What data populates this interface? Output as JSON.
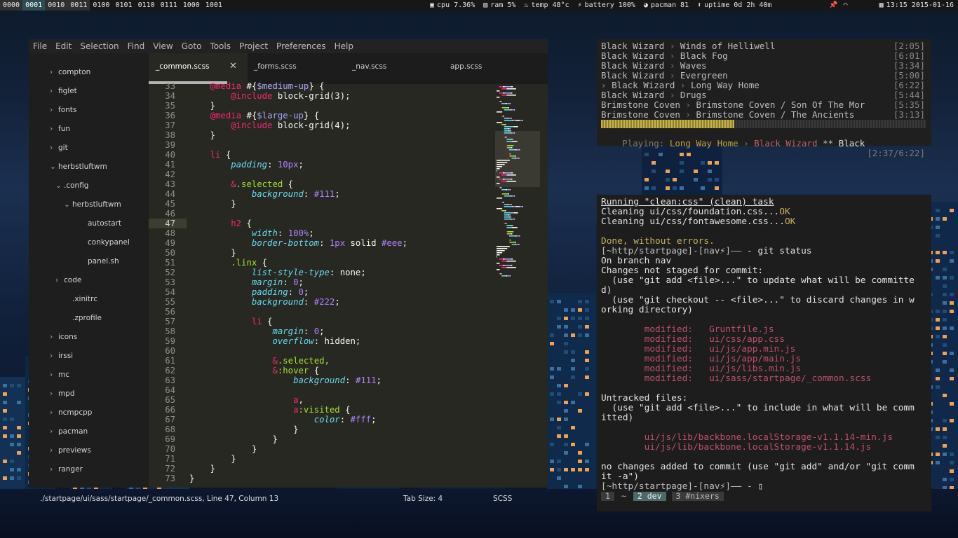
{
  "topbar": {
    "workspaces": [
      {
        "label": "0000",
        "state": "occ"
      },
      {
        "label": "0001",
        "state": "active"
      },
      {
        "label": "0010",
        "state": "occ"
      },
      {
        "label": "0011",
        "state": "occ"
      },
      {
        "label": "0100",
        "state": ""
      },
      {
        "label": "0101",
        "state": ""
      },
      {
        "label": "0110",
        "state": ""
      },
      {
        "label": "0111",
        "state": ""
      },
      {
        "label": "1000",
        "state": ""
      },
      {
        "label": "1001",
        "state": ""
      }
    ],
    "stats": [
      {
        "icon": "cpu-icon",
        "glyph": "▣",
        "text": "cpu 7.36%"
      },
      {
        "icon": "ram-icon",
        "glyph": "▤",
        "text": "ram 5%"
      },
      {
        "icon": "temperature-icon",
        "glyph": "♨",
        "text": "temp 48°c"
      },
      {
        "icon": "battery-icon",
        "glyph": "⚡",
        "text": "battery 100%"
      },
      {
        "icon": "package-icon",
        "glyph": "◕",
        "text": "pacman 81"
      },
      {
        "icon": "uptime-arrow-icon",
        "glyph": "⬆",
        "text": "uptime 0d 2h 40m"
      }
    ],
    "clock": "13:15 2015-01-16"
  },
  "editor": {
    "menu": [
      "File",
      "Edit",
      "Selection",
      "Find",
      "View",
      "Goto",
      "Tools",
      "Project",
      "Preferences",
      "Help"
    ],
    "tree": [
      {
        "label": "compton",
        "depth": 0,
        "chev": "›"
      },
      {
        "label": "figlet",
        "depth": 0,
        "chev": "›"
      },
      {
        "label": "fonts",
        "depth": 0,
        "chev": "›"
      },
      {
        "label": "fun",
        "depth": 0,
        "chev": "›"
      },
      {
        "label": "git",
        "depth": 0,
        "chev": "›"
      },
      {
        "label": "herbstluftwm",
        "depth": 0,
        "chev": "⌄"
      },
      {
        "label": ".config",
        "depth": 1,
        "chev": "⌄"
      },
      {
        "label": "herbstluftwm",
        "depth": 2,
        "chev": "⌄"
      },
      {
        "label": "autostart",
        "depth": 3,
        "chev": ""
      },
      {
        "label": "conkypanel",
        "depth": 3,
        "chev": ""
      },
      {
        "label": "panel.sh",
        "depth": 3,
        "chev": ""
      },
      {
        "label": "code",
        "depth": 1,
        "chev": "›"
      },
      {
        "label": ".xinitrc",
        "depth": 2,
        "chev": ""
      },
      {
        "label": ".zprofile",
        "depth": 2,
        "chev": ""
      },
      {
        "label": "icons",
        "depth": 0,
        "chev": "›"
      },
      {
        "label": "irssi",
        "depth": 0,
        "chev": "›"
      },
      {
        "label": "mc",
        "depth": 0,
        "chev": "›"
      },
      {
        "label": "mpd",
        "depth": 0,
        "chev": "›"
      },
      {
        "label": "ncmpcpp",
        "depth": 0,
        "chev": "›"
      },
      {
        "label": "pacman",
        "depth": 0,
        "chev": "›"
      },
      {
        "label": "previews",
        "depth": 0,
        "chev": "›"
      },
      {
        "label": "ranger",
        "depth": 0,
        "chev": "›"
      }
    ],
    "tabs": [
      "_common.scss",
      "_forms.scss",
      "_nav.scss",
      "app.scss"
    ],
    "current_line": 47,
    "code": [
      {
        "n": 33,
        "t": [
          [
            "    ",
            ""
          ],
          [
            "@media",
            "kw"
          ],
          [
            " #{",
            "wh"
          ],
          [
            "$medium-up",
            "vr"
          ],
          [
            "} {",
            "wh"
          ]
        ]
      },
      {
        "n": 34,
        "t": [
          [
            "        ",
            ""
          ],
          [
            "@include",
            "kw"
          ],
          [
            " block-grid(3);",
            "wh"
          ]
        ]
      },
      {
        "n": 35,
        "t": [
          [
            "    }",
            "wh"
          ]
        ]
      },
      {
        "n": 36,
        "t": [
          [
            "    ",
            ""
          ],
          [
            "@media",
            "kw"
          ],
          [
            " #{",
            "wh"
          ],
          [
            "$large-up",
            "vr"
          ],
          [
            "} {",
            "wh"
          ]
        ]
      },
      {
        "n": 37,
        "t": [
          [
            "        ",
            ""
          ],
          [
            "@include",
            "kw"
          ],
          [
            " block-grid(4);",
            "wh"
          ]
        ]
      },
      {
        "n": 38,
        "t": [
          [
            "    }",
            "wh"
          ]
        ]
      },
      {
        "n": 39,
        "t": []
      },
      {
        "n": 40,
        "t": [
          [
            "    ",
            ""
          ],
          [
            "li",
            "kw"
          ],
          [
            " {",
            "wh"
          ]
        ]
      },
      {
        "n": 41,
        "t": [
          [
            "        ",
            ""
          ],
          [
            "padding",
            "pr"
          ],
          [
            ": ",
            "wh"
          ],
          [
            "10px",
            "nm"
          ],
          [
            ";",
            "wh"
          ]
        ]
      },
      {
        "n": 42,
        "t": []
      },
      {
        "n": 43,
        "t": [
          [
            "        ",
            ""
          ],
          [
            "&",
            "kw"
          ],
          [
            ".selected",
            "gr"
          ],
          [
            " {",
            "wh"
          ]
        ]
      },
      {
        "n": 44,
        "t": [
          [
            "            ",
            ""
          ],
          [
            "background",
            "pr"
          ],
          [
            ": ",
            "wh"
          ],
          [
            "#111",
            "nm"
          ],
          [
            ";",
            "wh"
          ]
        ]
      },
      {
        "n": 45,
        "t": [
          [
            "        }",
            "wh"
          ]
        ]
      },
      {
        "n": 46,
        "t": []
      },
      {
        "n": 47,
        "t": [
          [
            "        ",
            ""
          ],
          [
            "h2",
            "kw"
          ],
          [
            " {",
            "wh"
          ]
        ]
      },
      {
        "n": 48,
        "t": [
          [
            "            ",
            ""
          ],
          [
            "width",
            "pr"
          ],
          [
            ": ",
            "wh"
          ],
          [
            "100%",
            "nm"
          ],
          [
            ";",
            "wh"
          ]
        ]
      },
      {
        "n": 49,
        "t": [
          [
            "            ",
            ""
          ],
          [
            "border-bottom",
            "pr"
          ],
          [
            ": ",
            "wh"
          ],
          [
            "1px",
            "nm"
          ],
          [
            " solid ",
            "wh"
          ],
          [
            "#eee",
            "nm"
          ],
          [
            ";",
            "wh"
          ]
        ]
      },
      {
        "n": 50,
        "t": [
          [
            "        }",
            "wh"
          ]
        ]
      },
      {
        "n": 51,
        "t": [
          [
            "        ",
            ""
          ],
          [
            ".linx",
            "gr"
          ],
          [
            " {",
            "wh"
          ]
        ]
      },
      {
        "n": 52,
        "t": [
          [
            "            ",
            ""
          ],
          [
            "list-style-type",
            "pr"
          ],
          [
            ": none;",
            "wh"
          ]
        ]
      },
      {
        "n": 53,
        "t": [
          [
            "            ",
            ""
          ],
          [
            "margin",
            "pr"
          ],
          [
            ": ",
            "wh"
          ],
          [
            "0",
            "nm"
          ],
          [
            ";",
            "wh"
          ]
        ]
      },
      {
        "n": 54,
        "t": [
          [
            "            ",
            ""
          ],
          [
            "padding",
            "pr"
          ],
          [
            ": ",
            "wh"
          ],
          [
            "0",
            "nm"
          ],
          [
            ";",
            "wh"
          ]
        ]
      },
      {
        "n": 55,
        "t": [
          [
            "            ",
            ""
          ],
          [
            "background",
            "pr"
          ],
          [
            ": ",
            "wh"
          ],
          [
            "#222",
            "nm"
          ],
          [
            ";",
            "wh"
          ]
        ]
      },
      {
        "n": 56,
        "t": []
      },
      {
        "n": 57,
        "t": [
          [
            "            ",
            ""
          ],
          [
            "li",
            "kw"
          ],
          [
            " {",
            "wh"
          ]
        ]
      },
      {
        "n": 58,
        "t": [
          [
            "                ",
            ""
          ],
          [
            "margin",
            "pr"
          ],
          [
            ": ",
            "wh"
          ],
          [
            "0",
            "nm"
          ],
          [
            ";",
            "wh"
          ]
        ]
      },
      {
        "n": 59,
        "t": [
          [
            "                ",
            ""
          ],
          [
            "overflow",
            "pr"
          ],
          [
            ": hidden;",
            "wh"
          ]
        ]
      },
      {
        "n": 60,
        "t": []
      },
      {
        "n": 61,
        "t": [
          [
            "                ",
            ""
          ],
          [
            "&",
            "kw"
          ],
          [
            ".selected,",
            "gr"
          ]
        ]
      },
      {
        "n": 62,
        "t": [
          [
            "                ",
            ""
          ],
          [
            "&",
            "kw"
          ],
          [
            ":hover",
            "gr"
          ],
          [
            " {",
            "wh"
          ]
        ]
      },
      {
        "n": 63,
        "t": [
          [
            "                    ",
            ""
          ],
          [
            "background",
            "pr"
          ],
          [
            ": ",
            "wh"
          ],
          [
            "#111",
            "nm"
          ],
          [
            ";",
            "wh"
          ]
        ]
      },
      {
        "n": 64,
        "t": []
      },
      {
        "n": 65,
        "t": [
          [
            "                    ",
            ""
          ],
          [
            "a",
            "kw"
          ],
          [
            ",",
            "wh"
          ]
        ]
      },
      {
        "n": 66,
        "t": [
          [
            "                    ",
            ""
          ],
          [
            "a",
            "kw"
          ],
          [
            ":visited",
            "gr"
          ],
          [
            " {",
            "wh"
          ]
        ]
      },
      {
        "n": 67,
        "t": [
          [
            "                        ",
            ""
          ],
          [
            "color",
            "pr"
          ],
          [
            ": ",
            "wh"
          ],
          [
            "#fff",
            "nm"
          ],
          [
            ";",
            "wh"
          ]
        ]
      },
      {
        "n": 68,
        "t": [
          [
            "                    }",
            "wh"
          ]
        ]
      },
      {
        "n": 69,
        "t": [
          [
            "                }",
            "wh"
          ]
        ]
      },
      {
        "n": 70,
        "t": [
          [
            "            }",
            "wh"
          ]
        ]
      },
      {
        "n": 71,
        "t": [
          [
            "        }",
            "wh"
          ]
        ]
      },
      {
        "n": 72,
        "t": [
          [
            "    }",
            "wh"
          ]
        ]
      },
      {
        "n": 73,
        "t": [
          [
            "}",
            "wh"
          ]
        ]
      }
    ],
    "status": {
      "path": "./startpage/ui/sass/startpage/_common.scss, Line 47, Column 13",
      "tab_size": "Tab Size: 4",
      "syntax": "SCSS"
    }
  },
  "music": {
    "tracks": [
      {
        "artist": "Black Wizard",
        "title": "Winds of Helliwell",
        "time": "[2:05]",
        "current": false
      },
      {
        "artist": "Black Wizard",
        "title": "Black Fog",
        "time": "[6:01]",
        "current": false
      },
      {
        "artist": "Black Wizard",
        "title": "Waves",
        "time": "[3:34]",
        "current": false
      },
      {
        "artist": "Black Wizard",
        "title": "Evergreen",
        "time": "[5:00]",
        "current": false
      },
      {
        "artist": "Black Wizard",
        "title": "Long Way Home",
        "time": "[6:22]",
        "current": true
      },
      {
        "artist": "Black Wizard",
        "title": "Drugs",
        "time": "[5:44]",
        "current": false
      },
      {
        "artist": "Brimstone Coven",
        "title": "Brimstone Coven / Son Of The Mor",
        "time": "[5:35]",
        "current": false
      },
      {
        "artist": "Brimstone Coven",
        "title": "Brimstone Coven / The Ancients",
        "time": "[3:13]",
        "current": false
      }
    ],
    "progress": 0.41,
    "playing_prefix": "Playing: ",
    "playing_title": "Long Way Home",
    "playing_artist": "Black Wizard",
    "playing_sep": " ** ",
    "playing_album": "Black",
    "playing_time": "[2:37/6:22]"
  },
  "terminal": {
    "lines": [
      {
        "segs": [
          [
            "Running \"clean:css\" (clean) task",
            "u"
          ]
        ]
      },
      {
        "segs": [
          [
            "Cleaning ui/css/foundation.css...",
            "w"
          ],
          [
            "OK",
            "y"
          ]
        ]
      },
      {
        "segs": [
          [
            "Cleaning ui/css/fontawesome.css...",
            "w"
          ],
          [
            "OK",
            "y"
          ]
        ]
      },
      {
        "segs": []
      },
      {
        "segs": [
          [
            "Done, without errors.",
            "y"
          ]
        ]
      },
      {
        "segs": [
          [
            "[~http/startpage]-[nav⚡]",
            ""
          ],
          [
            "—— ",
            ""
          ],
          [
            "- git status",
            "w"
          ]
        ]
      },
      {
        "segs": [
          [
            "On branch nav",
            "w"
          ]
        ]
      },
      {
        "segs": [
          [
            "Changes not staged for commit:",
            "w"
          ]
        ]
      },
      {
        "segs": [
          [
            "  (use \"git add <file>...\" to update what will be committe",
            "w"
          ]
        ]
      },
      {
        "segs": [
          [
            "d)",
            "w"
          ]
        ]
      },
      {
        "segs": [
          [
            "  (use \"git checkout -- <file>...\" to discard changes in w",
            "w"
          ]
        ]
      },
      {
        "segs": [
          [
            "orking directory)",
            "w"
          ]
        ]
      },
      {
        "segs": []
      },
      {
        "segs": [
          [
            "        modified:   Gruntfile.js",
            "r"
          ]
        ]
      },
      {
        "segs": [
          [
            "        modified:   ui/css/app.css",
            "r"
          ]
        ]
      },
      {
        "segs": [
          [
            "        modified:   ui/js/app.min.js",
            "r"
          ]
        ]
      },
      {
        "segs": [
          [
            "        modified:   ui/js/app/main.js",
            "r"
          ]
        ]
      },
      {
        "segs": [
          [
            "        modified:   ui/js/libs.min.js",
            "r"
          ]
        ]
      },
      {
        "segs": [
          [
            "        modified:   ui/sass/startpage/_common.scss",
            "r"
          ]
        ]
      },
      {
        "segs": []
      },
      {
        "segs": [
          [
            "Untracked files:",
            "w"
          ]
        ]
      },
      {
        "segs": [
          [
            "  (use \"git add <file>...\" to include in what will be comm",
            "w"
          ]
        ]
      },
      {
        "segs": [
          [
            "itted)",
            "w"
          ]
        ]
      },
      {
        "segs": []
      },
      {
        "segs": [
          [
            "        ui/js/lib/backbone.localStorage-v1.1.14-min.js",
            "r"
          ]
        ]
      },
      {
        "segs": [
          [
            "        ui/js/lib/backbone.localStorage-v1.1.14.js",
            "r"
          ]
        ]
      },
      {
        "segs": []
      },
      {
        "segs": [
          [
            "no changes added to commit (use \"git add\" and/or \"git comm",
            "w"
          ]
        ]
      },
      {
        "segs": [
          [
            "it -a\")",
            "w"
          ]
        ]
      },
      {
        "segs": [
          [
            "[~http/startpage]-[nav⚡]",
            ""
          ],
          [
            "—— - ",
            ""
          ],
          [
            "▯",
            "w"
          ]
        ]
      }
    ],
    "windows": [
      {
        "label": "1",
        "state": ""
      },
      {
        "label": "~",
        "state": "plain"
      },
      {
        "label": "2  dev",
        "state": "active"
      },
      {
        "label": "3  #nixers",
        "state": ""
      }
    ]
  },
  "colors": {
    "kw": "#f92672",
    "vr": "#a6a6ff",
    "pr": "#66d9ef",
    "nm": "#ae81ff",
    "gr": "#a6e22e",
    "wh": "#f8f8f2",
    "term_red": "#c0506a",
    "term_yellow": "#c8b45a",
    "accent": "#2d4d55"
  }
}
